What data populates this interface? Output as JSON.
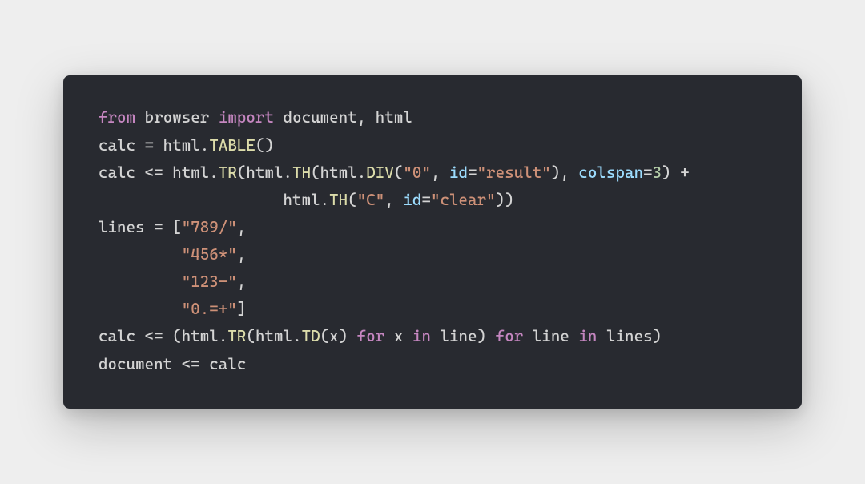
{
  "code": {
    "kw_from": "from",
    "mod_browser": "browser",
    "kw_import": "import",
    "import_list": "document, html",
    "l2_a": "calc = html.",
    "fn_table": "TABLE",
    "l2_b": "()",
    "l3_a": "calc <= html.",
    "fn_tr": "TR",
    "l3_b": "(html.",
    "fn_th": "TH",
    "l3_c": "(html.",
    "fn_div": "DIV",
    "l3_d": "(",
    "str_zero": "\"0\"",
    "l3_e": ", ",
    "arg_id1": "id",
    "l3_f": "=",
    "str_result": "\"result\"",
    "l3_g": "), ",
    "arg_colspan": "colspan",
    "l3_h": "=",
    "num_3": "3",
    "l3_i": ") +",
    "l4_pad": "                    html.",
    "l4_a": "(",
    "str_c": "\"C\"",
    "l4_b": ", ",
    "arg_id2": "id",
    "l4_c": "=",
    "str_clear": "\"clear\"",
    "l4_d": "))",
    "l5_a": "lines = [",
    "str_789": "\"789/\"",
    "l5_b": ",",
    "l6_pad": "         ",
    "str_456": "\"456*\"",
    "l6_b": ",",
    "str_123": "\"123-\"",
    "l7_b": ",",
    "str_0eq": "\"0.=+\"",
    "l8_b": "]",
    "l9_a": "calc <= (html.",
    "fn_td": "TD",
    "l9_b": "(html.",
    "l9_c": "(x) ",
    "kw_for": "for",
    "l9_d": " x ",
    "kw_in": "in",
    "l9_e": " line) ",
    "l9_f": " line ",
    "l9_g": " lines)",
    "l10": "document <= calc"
  }
}
